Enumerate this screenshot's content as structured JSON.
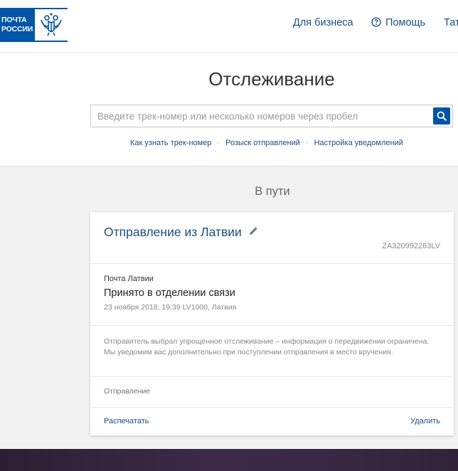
{
  "header": {
    "logo": {
      "line1": "ПОЧТА",
      "line2": "РОССИИ",
      "emblem_icon": "double-headed-eagle-icon"
    },
    "nav": [
      {
        "label": "Для бизнеса"
      },
      {
        "label": "Помощь",
        "icon": "help-circle-icon"
      },
      {
        "label": "Тат"
      }
    ]
  },
  "search": {
    "title": "Отслеживание",
    "placeholder": "Введите трек-номер или несколько номеров через пробел",
    "value": "",
    "button_icon": "search-icon",
    "links": [
      {
        "label": "Как узнать трек-номер"
      },
      {
        "label": "Розыск отправлений"
      },
      {
        "label": "Настройка уведомлений"
      }
    ]
  },
  "status": {
    "title": "В пути"
  },
  "shipment": {
    "title": "Отправление из Латвии",
    "track_number": "ZA320992263LV",
    "operator": "Почта Латвии",
    "event_status": "Принято в отделении связи",
    "event_meta": "23 ноября 2018, 19:39 LV1000, Латвия",
    "notice": "Отправитель выбрал упрощенное отслеживание – информация о передвижении ограничена. Мы уведомим вас дополнительно при поступлении отправления в место вручения.",
    "type_label": "Отправление",
    "print_label": "Распечатать",
    "delete_label": "Удалить"
  },
  "colors": {
    "brand_blue": "#0055a6",
    "link_blue": "#1c4e80",
    "background": "#f2f2f2",
    "footer": "#3c2a47"
  }
}
